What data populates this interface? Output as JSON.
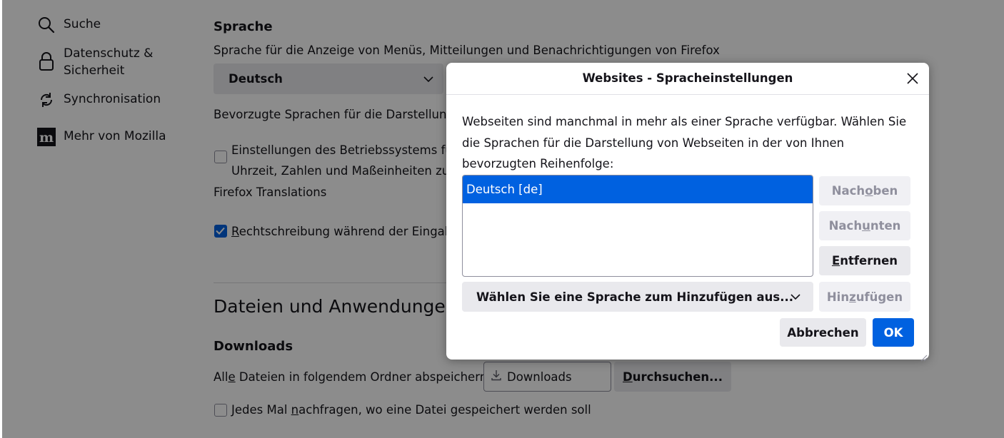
{
  "sidebar": {
    "items": [
      {
        "label": "Suche",
        "icon": "search-icon"
      },
      {
        "label": "Datenschutz & Sicherheit",
        "icon": "lock-icon"
      },
      {
        "label": "Synchronisation",
        "icon": "sync-icon"
      },
      {
        "label": "Mehr von Mozilla",
        "icon": "mozilla-icon"
      }
    ]
  },
  "language": {
    "heading": "Sprache",
    "description": "Sprache für die Anzeige von Menüs, Mitteilungen und Benachrichtigungen von Firefox",
    "selected": "Deutsch",
    "preferred_text": "Bevorzugte Sprachen für die Darstellung v",
    "os_settings_line1": "Einstellungen des Betriebssystems für „",
    "os_settings_line2": "Uhrzeit, Zahlen und Maßeinheiten zu fo",
    "translations": "Firefox Translations",
    "spellcheck_first": "R",
    "spellcheck_rest": "echtschreibung während der Eingabe"
  },
  "files": {
    "heading": "Dateien und Anwendungen",
    "downloads_heading": "Downloads",
    "save_label_pre": "All",
    "save_label_u": "e",
    "save_label_post": " Dateien in folgendem Ordner abspeichern:",
    "folder": "Downloads",
    "browse_first": "D",
    "browse_rest": "urchsuchen...",
    "ask_pre": "Jedes Mal ",
    "ask_u": "n",
    "ask_post": "achfragen, wo eine Datei gespeichert werden soll"
  },
  "dialog": {
    "title": "Websites - Spracheinstellungen",
    "description": "Webseiten sind manchmal in mehr als einer Sprache verfügbar. Wählen Sie die Sprachen für die Darstellung von Webseiten in der von Ihnen bevorzugten Reihenfolge:",
    "languages": [
      "Deutsch [de]"
    ],
    "move_up_pre": "Nach ",
    "move_up_u": "o",
    "move_up_post": "ben",
    "move_down_pre": "Nach ",
    "move_down_u": "u",
    "move_down_post": "nten",
    "remove_u": "E",
    "remove_post": "ntfernen",
    "add_select": "Wählen Sie eine Sprache zum Hinzufügen aus...",
    "add_pre": "Hin",
    "add_u": "z",
    "add_post": "ufügen",
    "cancel": "Abbrechen",
    "ok": "OK"
  },
  "colors": {
    "accent": "#0061e0",
    "overlay": "rgba(0,0,0,0.45)"
  }
}
